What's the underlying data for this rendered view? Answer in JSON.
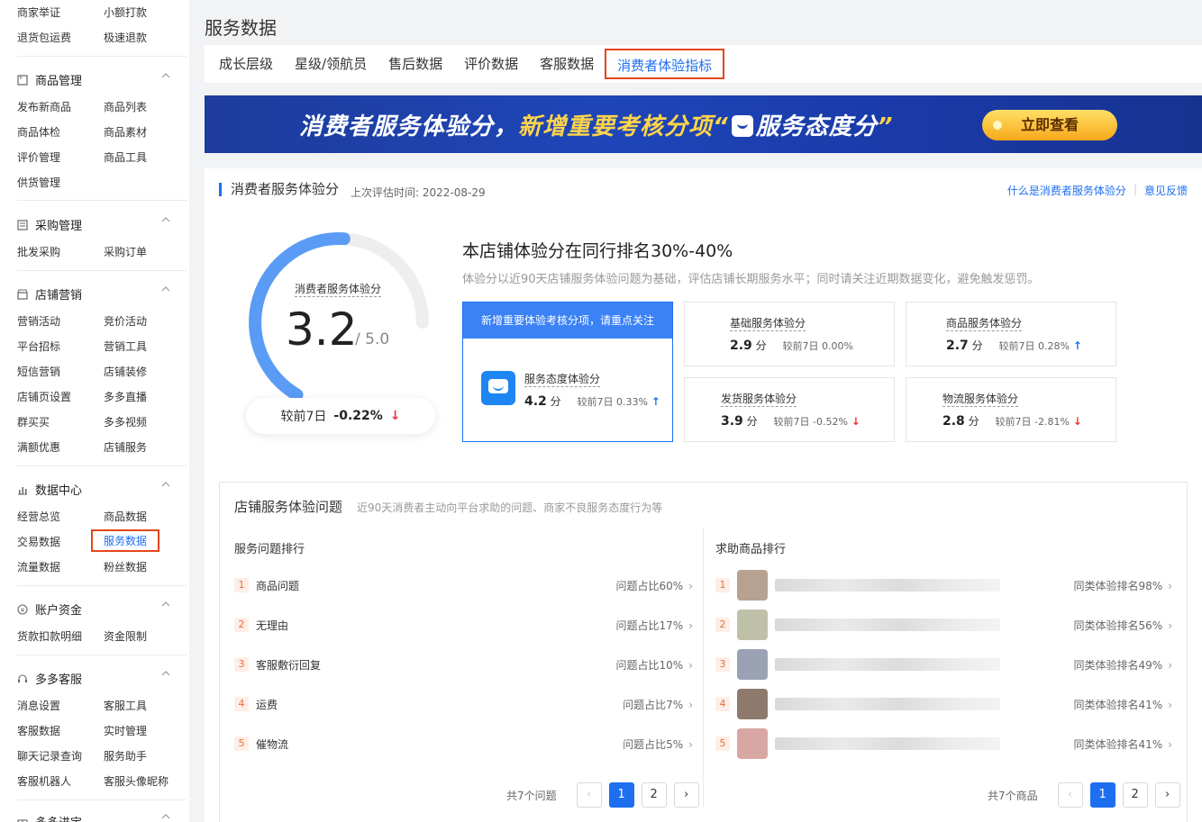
{
  "sidebar": {
    "top_pairs": [
      [
        "商家举证",
        "小额打款"
      ],
      [
        "退货包运费",
        "极速退款"
      ]
    ],
    "groups": [
      {
        "title": "商品管理",
        "icon": "box-icon",
        "items": [
          [
            "发布新商品",
            "商品列表"
          ],
          [
            "商品体检",
            "商品素材"
          ],
          [
            "评价管理",
            "商品工具"
          ],
          [
            "供货管理",
            ""
          ]
        ]
      },
      {
        "title": "采购管理",
        "icon": "list-icon",
        "items": [
          [
            "批发采购",
            "采购订单"
          ]
        ]
      },
      {
        "title": "店铺营销",
        "icon": "store-icon",
        "items": [
          [
            "营销活动",
            "竞价活动"
          ],
          [
            "平台招标",
            "营销工具"
          ],
          [
            "短信营销",
            "店铺装修"
          ],
          [
            "店铺页设置",
            "多多直播"
          ],
          [
            "群买买",
            "多多视频"
          ],
          [
            "满额优惠",
            "店铺服务"
          ]
        ]
      },
      {
        "title": "数据中心",
        "icon": "bar-chart-icon",
        "items": [
          [
            "经营总览",
            "商品数据"
          ],
          [
            "交易数据",
            "服务数据"
          ],
          [
            "流量数据",
            "粉丝数据"
          ]
        ]
      },
      {
        "title": "账户资金",
        "icon": "yuan-icon",
        "items": [
          [
            "货款扣款明细",
            "资金限制"
          ]
        ]
      },
      {
        "title": "多多客服",
        "icon": "headset-icon",
        "items": [
          [
            "消息设置",
            "客服工具"
          ],
          [
            "客服数据",
            "实时管理"
          ],
          [
            "聊天记录查询",
            "服务助手"
          ],
          [
            "客服机器人",
            "客服头像昵称"
          ]
        ]
      },
      {
        "title": "多多进宝",
        "icon": "gift-icon",
        "items": []
      }
    ],
    "active_item": "服务数据"
  },
  "header": {
    "title": "服务数据",
    "tabs": [
      "成长层级",
      "星级/领航员",
      "售后数据",
      "评价数据",
      "客服数据",
      "消费者体验指标"
    ],
    "active_tab": "消费者体验指标"
  },
  "banner": {
    "text_a": "消费者服务体验分，",
    "text_b": "新增重要考核分项",
    "text_c": "“",
    "text_d": "服务态度分",
    "text_e": "”",
    "button": "立即查看"
  },
  "score_section": {
    "title": "消费者服务体验分",
    "eval_time": "上次评估时间: 2022-08-29",
    "link_what": "什么是消费者服务体验分",
    "link_feedback": "意见反馈",
    "gauge_label": "消费者服务体验分",
    "score": "3.2",
    "max": "/ 5.0",
    "score_value": 3.2,
    "score_max": 5.0,
    "compare_label": "较前7日",
    "compare_value": "-0.22%",
    "rank_title": "本店铺体验分在同行排名30%-40%",
    "rank_desc": "体验分以近90天店铺服务体验问题为基础，评估店铺长期服务水平；同时请关注近期数据变化，避免触发惩罚。",
    "highlight": {
      "header": "新增重要体验考核分项，请重点关注",
      "label": "服务态度体验分",
      "value": "4.2",
      "unit": "分",
      "compare": "较前7日 0.33%",
      "trend": "up"
    },
    "metrics": [
      {
        "label": "基础服务体验分",
        "value": "2.9",
        "unit": "分",
        "compare": "较前7日 0.00%",
        "trend": "none"
      },
      {
        "label": "商品服务体验分",
        "value": "2.7",
        "unit": "分",
        "compare": "较前7日 0.28%",
        "trend": "up"
      },
      {
        "label": "发货服务体验分",
        "value": "3.9",
        "unit": "分",
        "compare": "较前7日 -0.52%",
        "trend": "down"
      },
      {
        "label": "物流服务体验分",
        "value": "2.8",
        "unit": "分",
        "compare": "较前7日 -2.81%",
        "trend": "down"
      }
    ]
  },
  "problems": {
    "title": "店铺服务体验问题",
    "subtitle": "近90天消费者主动向平台求助的问题、商家不良服务态度行为等",
    "left_title": "服务问题排行",
    "right_title": "求助商品排行",
    "issues": [
      {
        "rank": "1",
        "name": "商品问题",
        "ratio": "问题占比60%"
      },
      {
        "rank": "2",
        "name": "无理由",
        "ratio": "问题占比17%"
      },
      {
        "rank": "3",
        "name": "客服敷衍回复",
        "ratio": "问题占比10%"
      },
      {
        "rank": "4",
        "name": "运费",
        "ratio": "问题占比7%"
      },
      {
        "rank": "5",
        "name": "催物流",
        "ratio": "问题占比5%"
      }
    ],
    "products": [
      {
        "rank": "1",
        "ratio": "同类体验排名98%"
      },
      {
        "rank": "2",
        "ratio": "同类体验排名56%"
      },
      {
        "rank": "3",
        "ratio": "同类体验排名49%"
      },
      {
        "rank": "4",
        "ratio": "同类体验排名41%"
      },
      {
        "rank": "5",
        "ratio": "同类体验排名41%"
      }
    ],
    "left_total": "共7个问题",
    "right_total": "共7个商品",
    "pages": [
      "1",
      "2"
    ],
    "prev": "‹",
    "next": "›"
  },
  "colors": {
    "accent": "#1d6ff0",
    "highlight_border": "#e5461c",
    "down": "#e33333",
    "up": "#1d6ff0",
    "gauge_track": "#eeeeee",
    "gauge_fill": "#5a9bf5"
  }
}
